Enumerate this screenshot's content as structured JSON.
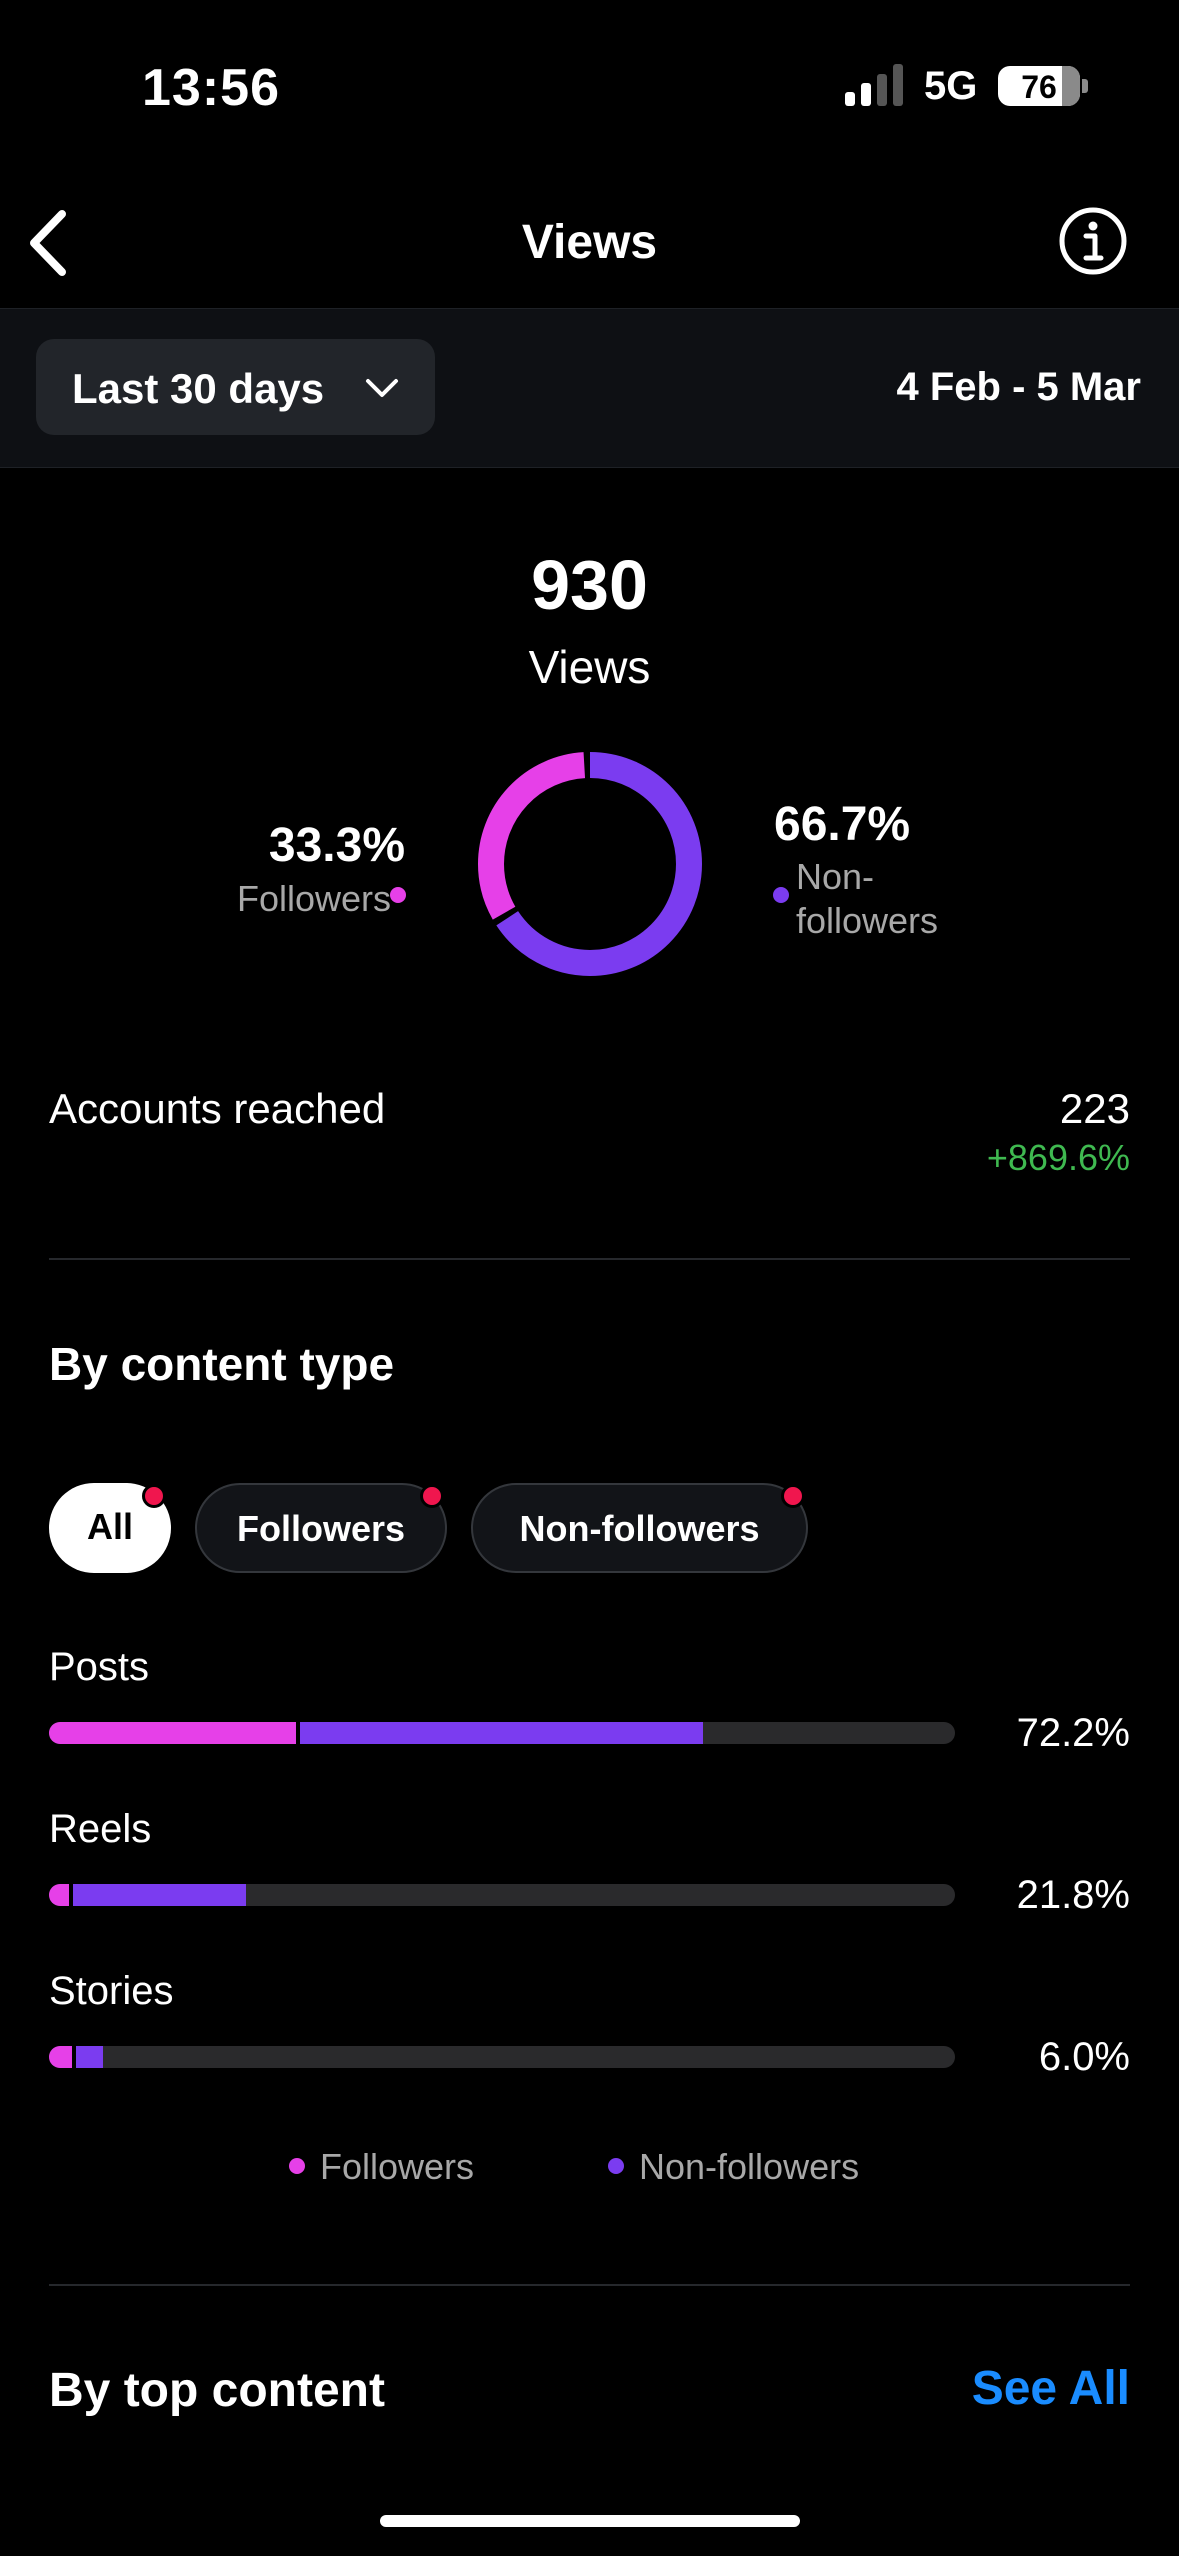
{
  "status_bar": {
    "time": "13:56",
    "network": "5G",
    "battery": "76"
  },
  "header": {
    "title": "Views",
    "back_icon": "chevron-left-icon",
    "info_icon": "info-icon"
  },
  "filter": {
    "range_label": "Last 30 days",
    "date_range": "4 Feb - 5 Mar"
  },
  "summary": {
    "total": "930",
    "total_label": "Views",
    "followers": {
      "percent": "33.3%",
      "label": "Followers",
      "value": 33.3
    },
    "non_followers": {
      "percent": "66.7%",
      "label": "Non-followers",
      "value": 66.7
    }
  },
  "reach": {
    "label": "Accounts reached",
    "value": "223",
    "change": "+869.6%"
  },
  "content_type": {
    "heading": "By content type",
    "tabs": [
      {
        "label": "All",
        "selected": true
      },
      {
        "label": "Followers",
        "selected": false
      },
      {
        "label": "Non-followers",
        "selected": false
      }
    ],
    "rows": [
      {
        "label": "Posts",
        "percent": "72.2%",
        "total": 72.2,
        "followers": 27.7
      },
      {
        "label": "Reels",
        "percent": "21.8%",
        "total": 21.8,
        "followers": 2.6
      },
      {
        "label": "Stories",
        "percent": "6.0%",
        "total": 6.0,
        "followers": 3.0
      }
    ],
    "legend": [
      {
        "label": "Followers",
        "color": "#e640e8"
      },
      {
        "label": "Non-followers",
        "color": "#7b3cf0"
      }
    ]
  },
  "top_content": {
    "heading": "By top content",
    "see_all": "See All"
  },
  "colors": {
    "followers": "#e640e8",
    "non_followers": "#7b3cf0",
    "positive": "#3fb950",
    "link": "#1a8cff",
    "notification_dot": "#f0164e"
  }
}
